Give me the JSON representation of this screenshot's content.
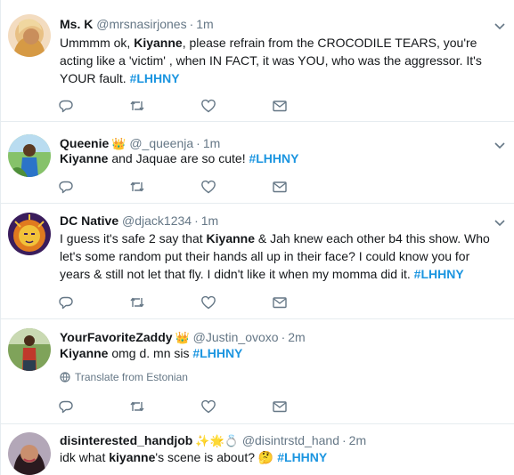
{
  "tweets": [
    {
      "name": "Ms. K",
      "handle": "@mrsnasirjones",
      "time": "1m",
      "body": [
        {
          "text": "Ummmm ok, "
        },
        {
          "text": "Kiyanne",
          "style": "hl"
        },
        {
          "text": ", please refrain from the CROCODILE TEARS, you're acting like a 'victim' , when IN FACT, it was YOU, who was the aggressor. It's YOUR fault. "
        },
        {
          "text": "#LHHNY",
          "style": "tag"
        }
      ]
    },
    {
      "name": "Queenie",
      "badge": "👑",
      "handle": "@_queenja",
      "time": "1m",
      "body": [
        {
          "text": "Kiyanne",
          "style": "hl"
        },
        {
          "text": " and Jaquae are so cute! "
        },
        {
          "text": "#LHHNY",
          "style": "tag"
        }
      ]
    },
    {
      "name": "DC Native",
      "handle": "@djack1234",
      "time": "1m",
      "body": [
        {
          "text": "I guess it's safe 2 say that "
        },
        {
          "text": "Kiyanne",
          "style": "hl"
        },
        {
          "text": " & Jah knew each other b4 this show. Who let's some random put their hands all up in their face? I could know you for years & still not let that fly. I didn't like it when my momma did it.  "
        },
        {
          "text": "#LHHNY",
          "style": "tag"
        }
      ]
    },
    {
      "name": "YourFavoriteZaddy",
      "badge": "👑",
      "handle": "@Justin_ovoxo",
      "time": "2m",
      "body": [
        {
          "text": "Kiyanne",
          "style": "hl"
        },
        {
          "text": " omg d. mn sis "
        },
        {
          "text": "#LHHNY",
          "style": "tag"
        }
      ],
      "translate": "Translate from Estonian"
    },
    {
      "name": "disinterested_handjob",
      "badge": "✨🌟💍",
      "handle": "@disintrstd_hand",
      "time": "2m",
      "body": [
        {
          "text": "idk what "
        },
        {
          "text": "kiyanne",
          "style": "hl"
        },
        {
          "text": "'s scene is about? 🤔  "
        },
        {
          "text": "#LHHNY",
          "style": "tag"
        }
      ]
    }
  ],
  "separator": "·",
  "icons": {
    "reply": "reply-icon",
    "retweet": "retweet-icon",
    "like": "heart-icon",
    "dm": "envelope-icon",
    "caret": "chevron-down-icon",
    "globe": "globe-icon"
  },
  "colors": {
    "hashtag": "#1b95e0",
    "muted": "#657786",
    "text": "#14171a",
    "divider": "#e6ecf0"
  }
}
